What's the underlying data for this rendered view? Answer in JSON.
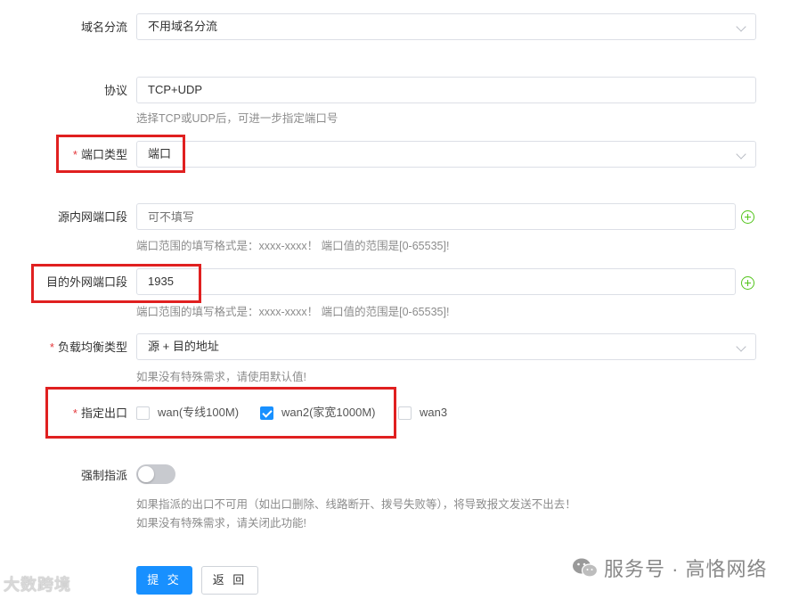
{
  "form": {
    "domain_split": {
      "label": "域名分流",
      "value": "不用域名分流"
    },
    "protocol": {
      "label": "协议",
      "value": "TCP+UDP",
      "hint": "选择TCP或UDP后，可进一步指定端口号"
    },
    "port_type": {
      "required_mark": "*",
      "label": "端口类型",
      "value": "端口"
    },
    "src_port": {
      "label": "源内网端口段",
      "placeholder": "可不填写",
      "hint": "端口范围的填写格式是：xxxx-xxxx！ 端口值的范围是[0-65535]!"
    },
    "dst_port": {
      "label": "目的外网端口段",
      "value": "1935",
      "hint": "端口范围的填写格式是：xxxx-xxxx！ 端口值的范围是[0-65535]!"
    },
    "lb_type": {
      "required_mark": "*",
      "label": "负载均衡类型",
      "value": "源 + 目的地址",
      "hint": "如果没有特殊需求，请使用默认值!"
    },
    "outlet": {
      "required_mark": "*",
      "label": "指定出口",
      "options": [
        {
          "label": "wan(专线100M)",
          "checked": false
        },
        {
          "label": "wan2(家宽1000M)",
          "checked": true
        },
        {
          "label": "wan3",
          "checked": false
        }
      ]
    },
    "force": {
      "label": "强制指派",
      "on": false,
      "hint1": "如果指派的出口不可用（如出口删除、线路断开、拨号失败等），将导致报文发送不出去！",
      "hint2": "如果没有特殊需求，请关闭此功能!"
    }
  },
  "buttons": {
    "submit": "提 交",
    "back": "返 回"
  },
  "watermarks": {
    "left": "大数跨境",
    "right": "服务号 · 高恪网络"
  },
  "colors": {
    "primary": "#1890ff",
    "required": "#e4393c",
    "highlight_box": "#e02020",
    "add": "#52c41a"
  }
}
